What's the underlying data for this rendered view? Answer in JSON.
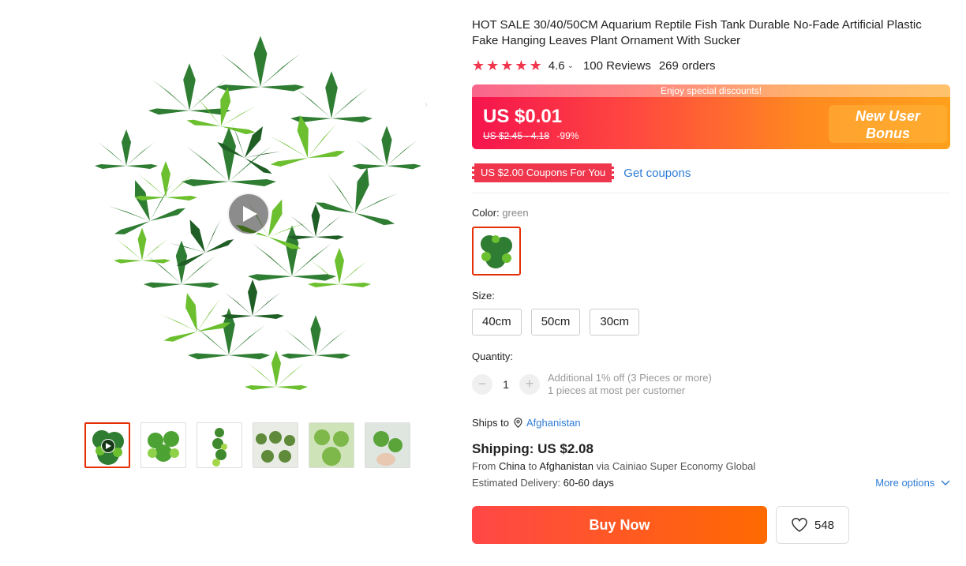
{
  "product": {
    "title": "HOT SALE 30/40/50CM Aquarium Reptile Fish Tank Durable No-Fade Artificial Plastic Fake Hanging Leaves Plant Ornament With Sucker",
    "rating": "4.6",
    "reviews": "100 Reviews",
    "orders": "269 orders"
  },
  "price": {
    "banner": "Enjoy special discounts!",
    "current": "US $0.01",
    "original": "US $2.45 - 4.18",
    "discount": "-99%",
    "bonus_line1": "New User",
    "bonus_line2": "Bonus"
  },
  "coupon": {
    "tag": "US $2.00 Coupons For You",
    "link": "Get coupons"
  },
  "color": {
    "label": "Color:",
    "value": "green"
  },
  "size": {
    "label": "Size:",
    "options": [
      "40cm",
      "50cm",
      "30cm"
    ]
  },
  "quantity": {
    "label": "Quantity:",
    "value": "1",
    "minus": "−",
    "plus": "+",
    "note1": "Additional 1% off (3 Pieces or more)",
    "note2": "1 pieces at most per customer"
  },
  "shipping": {
    "ships_to_label": "Ships to",
    "country": "Afghanistan",
    "title": "Shipping: US $2.08",
    "from_prefix": "From",
    "from": "China",
    "to_word": "to",
    "to": "Afghanistan",
    "via": "via Cainiao Super Economy Global",
    "delivery_label": "Estimated Delivery:",
    "delivery_value": "60-60 days",
    "more_options": "More options"
  },
  "actions": {
    "buy_now": "Buy Now",
    "wishlist_count": "548"
  },
  "icons": {
    "play": "play-icon",
    "star": "star-icon",
    "pin": "location-pin-icon",
    "heart": "heart-icon",
    "chevron": "chevron-down-icon"
  },
  "colors": {
    "accent": "#f0364d",
    "link": "#2e7bd6",
    "buy_start": "#ff4747",
    "buy_end": "#ff6a00"
  }
}
